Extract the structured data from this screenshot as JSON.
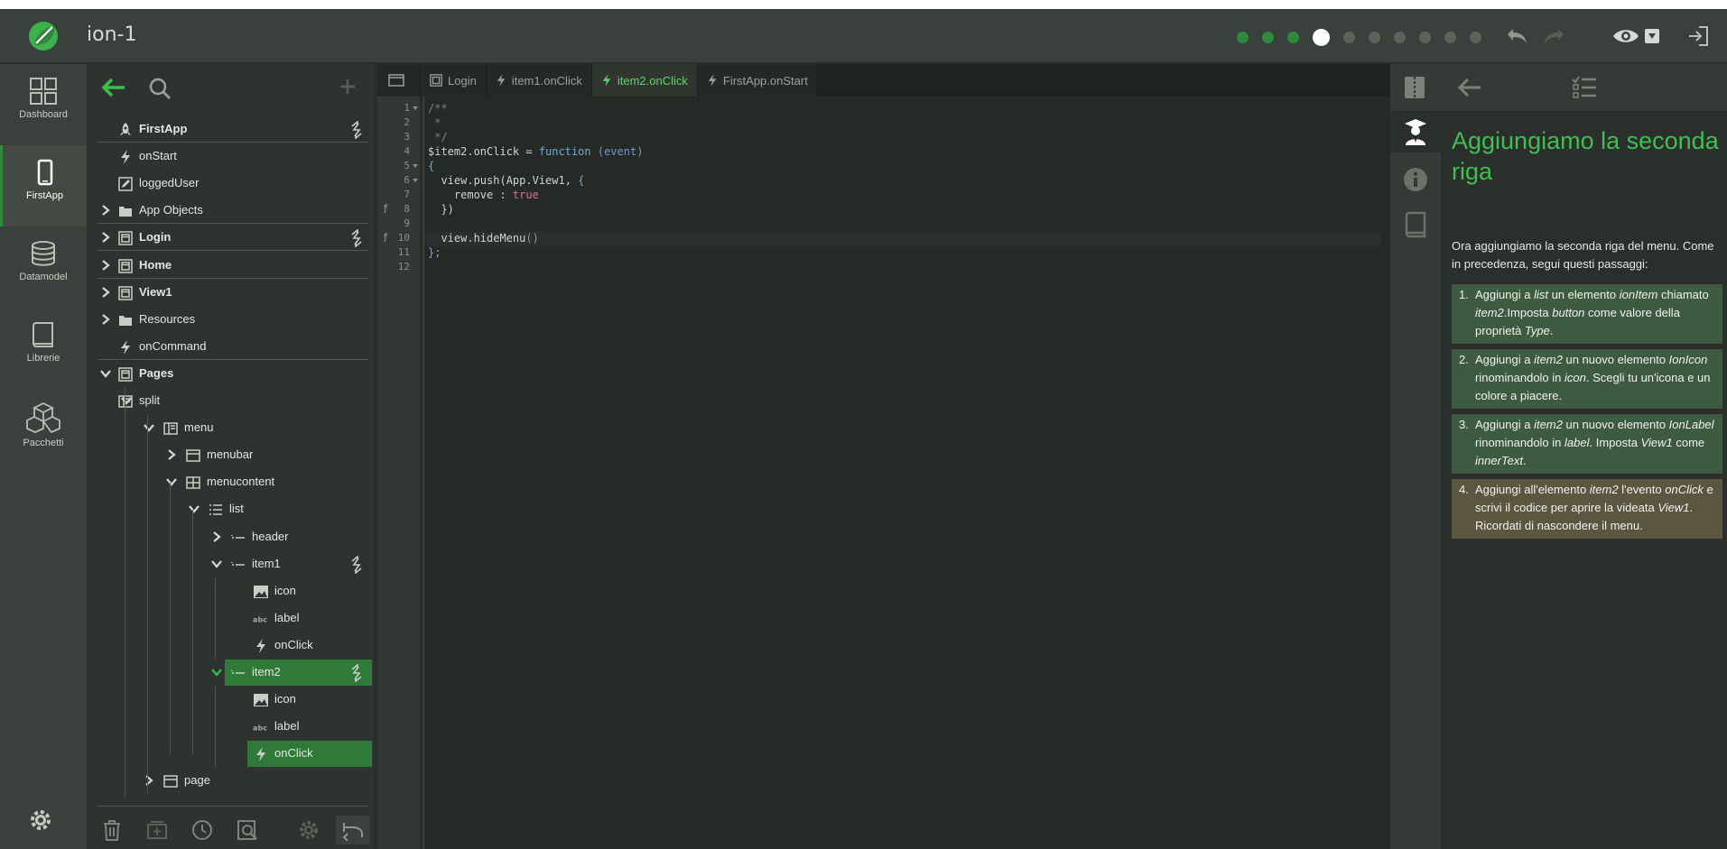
{
  "app": {
    "title": "ion-1"
  },
  "colors": {
    "accent": "#2f8a3e",
    "accent_text": "#3fbf52",
    "bg": "#2b2f2c"
  },
  "steps": {
    "total": 10,
    "completed": 3,
    "current_index": 4
  },
  "nav": {
    "items": [
      {
        "label": "Dashboard",
        "icon": "dashboard-icon"
      },
      {
        "label": "FirstApp",
        "icon": "phone-icon"
      },
      {
        "label": "Datamodel",
        "icon": "database-icon"
      },
      {
        "label": "Librerie",
        "icon": "book-icon"
      },
      {
        "label": "Pacchetti",
        "icon": "boxes-icon"
      }
    ]
  },
  "tree": {
    "items": [
      {
        "label": "FirstApp",
        "icon": "rocket-icon",
        "bold": true,
        "sep": true,
        "bolt": true
      },
      {
        "label": "onStart",
        "icon": "bolt-icon"
      },
      {
        "label": "loggedUser",
        "icon": "edit-icon"
      },
      {
        "label": "App Objects",
        "icon": "folder-icon",
        "chevron": "right",
        "sep": true
      },
      {
        "label": "Login",
        "icon": "page-icon",
        "bold": true,
        "chevron": "right",
        "sep": true,
        "bolt": true
      },
      {
        "label": "Home",
        "icon": "page-icon",
        "bold": true,
        "chevron": "right",
        "sep": true
      },
      {
        "label": "View1",
        "icon": "page-icon",
        "bold": true,
        "chevron": "right"
      },
      {
        "label": "Resources",
        "icon": "folder-icon",
        "chevron": "right"
      },
      {
        "label": "onCommand",
        "icon": "bolt-icon",
        "sep": true
      },
      {
        "label": "Pages",
        "icon": "page-icon",
        "bold": true,
        "chevron": "down"
      },
      {
        "label": "split",
        "icon": "split-icon",
        "chevron": "down"
      },
      {
        "label": "menu",
        "icon": "split-icon",
        "chevron": "down"
      },
      {
        "label": "menubar",
        "icon": "bar-icon",
        "chevron": "right"
      },
      {
        "label": "menucontent",
        "icon": "grid-icon",
        "chevron": "down"
      },
      {
        "label": "list",
        "icon": "list-icon",
        "chevron": "down"
      },
      {
        "label": "header",
        "icon": "item-icon",
        "chevron": "right"
      },
      {
        "label": "item1",
        "icon": "item-icon",
        "chevron": "down",
        "bolt": true
      },
      {
        "label": "icon",
        "icon": "image-icon"
      },
      {
        "label": "label",
        "icon": "abc-icon"
      },
      {
        "label": "onClick",
        "icon": "bolt-icon"
      },
      {
        "label": "item2",
        "icon": "item-icon",
        "chevron": "down",
        "bolt": true,
        "selected": true
      },
      {
        "label": "icon",
        "icon": "image-icon"
      },
      {
        "label": "label",
        "icon": "abc-icon"
      },
      {
        "label": "onClick",
        "icon": "bolt-icon",
        "selected": true
      },
      {
        "label": "page",
        "icon": "bar-icon",
        "chevron": "right"
      }
    ]
  },
  "tabs": [
    {
      "label": "Login",
      "icon": "page-icon"
    },
    {
      "label": "item1.onClick",
      "icon": "bolt-icon"
    },
    {
      "label": "item2.onClick",
      "icon": "bolt-icon",
      "active": true
    },
    {
      "label": "FirstApp.onStart",
      "icon": "bolt-icon"
    }
  ],
  "code": {
    "line_numbers": [
      "1",
      "2",
      "3",
      "4",
      "5",
      "6",
      "7",
      "8",
      "9",
      "10",
      "11",
      "12"
    ],
    "fold_lines": [
      "1",
      "5",
      "6"
    ],
    "f_marks": [
      "8",
      "10"
    ],
    "lines": [
      [
        [
          "c-com",
          "/**"
        ]
      ],
      [
        [
          "c-com",
          " *"
        ]
      ],
      [
        [
          "c-com",
          " */"
        ]
      ],
      [
        [
          "",
          "$item2.onClick = "
        ],
        [
          "c-kw",
          "function"
        ],
        [
          "",
          " "
        ],
        [
          "c-par",
          "(event)"
        ]
      ],
      [
        [
          "c-kw",
          "{"
        ]
      ],
      [
        [
          "",
          "  view.push(App.View1, "
        ],
        [
          "c-kw",
          "{"
        ]
      ],
      [
        [
          "",
          "    remove : "
        ],
        [
          "c-str",
          "true"
        ]
      ],
      [
        [
          "",
          "  })"
        ]
      ],
      [
        [
          "",
          ""
        ]
      ],
      [
        [
          "",
          "  view.hideMenu"
        ],
        [
          "c-par",
          "()"
        ]
      ],
      [
        [
          "c-kw",
          "};"
        ]
      ],
      [
        [
          "",
          ""
        ]
      ]
    ]
  },
  "help": {
    "title": "Aggiungiamo la seconda riga",
    "intro": "Ora aggiungiamo la seconda riga del menu. Come in precedenza, segui questi passaggi:",
    "steps": [
      {
        "num": "1.",
        "html": "Aggiungi a <i>list</i> un elemento <i>ionItem</i> chiamato <i>item2</i>.Imposta <i>button</i> come valore della proprietà <i>Type</i>."
      },
      {
        "num": "2.",
        "html": "Aggiungi a <i>item2</i> un nuovo elemento <i>IonIcon</i> rinominandolo in <i>icon</i>. Scegli tu un'icona e un colore a piacere."
      },
      {
        "num": "3.",
        "html": "Aggiungi a <i>item2</i> un nuovo elemento <i>IonLabel</i> rinominandolo in <i>label</i>. Imposta <i>View1</i> come <i>innerText</i>."
      },
      {
        "num": "4.",
        "html": "Aggiungi all'elemento <i>item2</i> l'evento <i>onClick</i> e scrivi il codice per aprire la videata <i>View1</i>. Ricordati di nascondere il menu.",
        "current": true
      }
    ]
  }
}
